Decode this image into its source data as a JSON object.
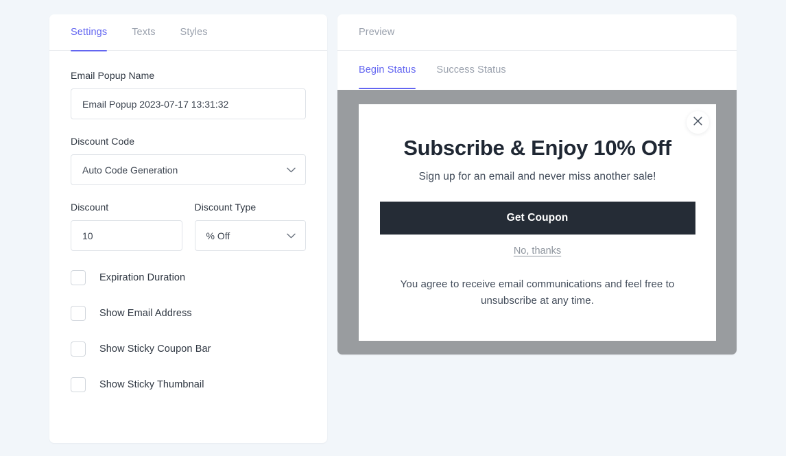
{
  "settings_panel": {
    "tabs": [
      {
        "label": "Settings",
        "active": true
      },
      {
        "label": "Texts",
        "active": false
      },
      {
        "label": "Styles",
        "active": false
      }
    ],
    "name_field": {
      "label": "Email Popup Name",
      "value": "Email Popup 2023-07-17 13:31:32",
      "placeholder": "Email Popup Name"
    },
    "discount_code_field": {
      "label": "Discount Code",
      "value": "Auto Code Generation",
      "options": [
        "Auto Code Generation"
      ]
    },
    "discount_field": {
      "label": "Discount",
      "value": "10",
      "placeholder": "Discount"
    },
    "discount_type_field": {
      "label": "Discount Type",
      "value": "% Off",
      "options": [
        "% Off"
      ]
    },
    "checkboxes": [
      {
        "label": "Expiration Duration",
        "checked": false
      },
      {
        "label": "Show Email Address",
        "checked": false
      },
      {
        "label": "Show Sticky Coupon Bar",
        "checked": false
      },
      {
        "label": "Show Sticky Thumbnail",
        "checked": false
      }
    ]
  },
  "preview_panel": {
    "header_title": "Preview",
    "status_tabs": [
      {
        "label": "Begin Status",
        "active": true
      },
      {
        "label": "Success Status",
        "active": false
      }
    ],
    "popup": {
      "title": "Subscribe & Enjoy 10% Off",
      "subtitle": "Sign up for an email and never miss another sale!",
      "cta_label": "Get Coupon",
      "decline_label": "No, thanks",
      "consent_text": "You agree to receive email communications and feel free to unsubscribe at any time.",
      "close_icon": "close-icon"
    }
  },
  "colors": {
    "accent": "#6366f1",
    "page_background": "#f2f6fa",
    "overlay": "#999c9f",
    "cta_background": "#252c36",
    "text_primary": "#2e3641",
    "text_muted": "#9aa1ad"
  }
}
